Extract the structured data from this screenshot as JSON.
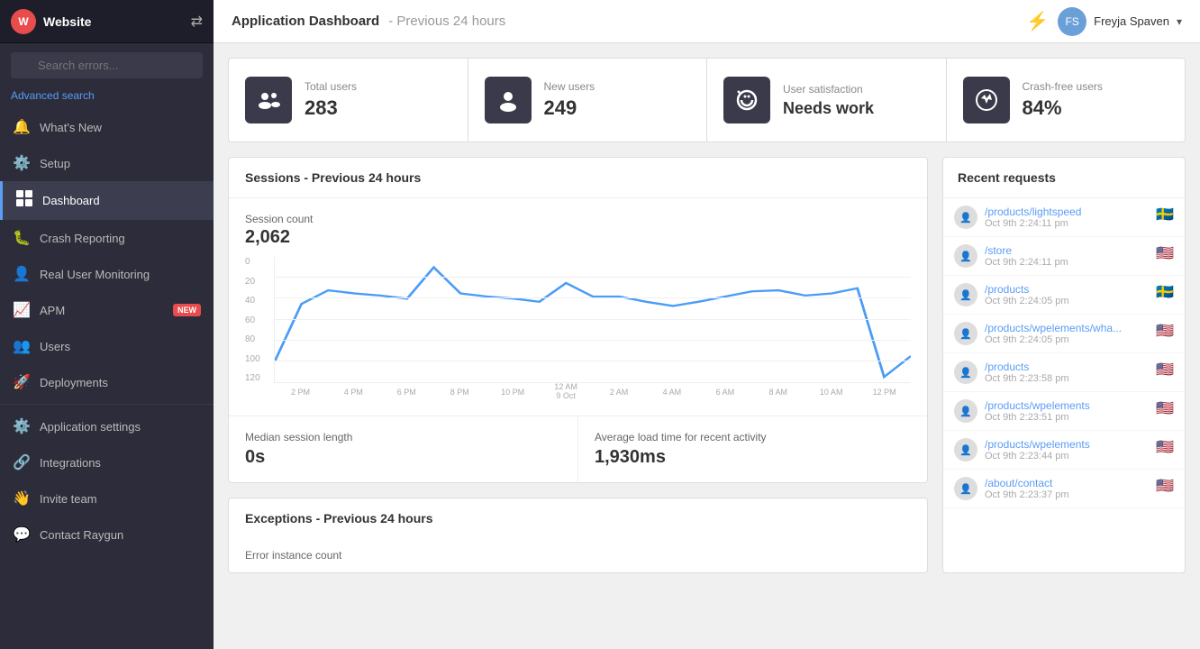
{
  "app": {
    "name": "Website",
    "icon_letter": "W"
  },
  "topbar": {
    "lightning_icon": "⚡",
    "page_title": "Application Dashboard",
    "page_subtitle": "- Previous 24 hours",
    "user_name": "Freyja Spaven",
    "user_initials": "FS"
  },
  "search": {
    "placeholder": "Search errors...",
    "advanced_link": "Advanced search"
  },
  "nav": {
    "items": [
      {
        "id": "whats-new",
        "label": "What's New",
        "icon": "🔔",
        "active": false
      },
      {
        "id": "setup",
        "label": "Setup",
        "icon": "⚙️",
        "active": false
      },
      {
        "id": "dashboard",
        "label": "Dashboard",
        "icon": "📊",
        "active": true
      },
      {
        "id": "crash-reporting",
        "label": "Crash Reporting",
        "icon": "🐛",
        "active": false
      },
      {
        "id": "real-user-monitoring",
        "label": "Real User Monitoring",
        "icon": "👤",
        "active": false
      },
      {
        "id": "apm",
        "label": "APM",
        "icon": "📈",
        "active": false,
        "badge": "NEW"
      },
      {
        "id": "users",
        "label": "Users",
        "icon": "👥",
        "active": false
      },
      {
        "id": "deployments",
        "label": "Deployments",
        "icon": "🚀",
        "active": false
      },
      {
        "id": "application-settings",
        "label": "Application settings",
        "icon": "⚙️",
        "active": false
      },
      {
        "id": "integrations",
        "label": "Integrations",
        "icon": "🔗",
        "active": false
      },
      {
        "id": "invite-team",
        "label": "Invite team",
        "icon": "👋",
        "active": false
      },
      {
        "id": "contact-raygun",
        "label": "Contact Raygun",
        "icon": "💬",
        "active": false
      }
    ]
  },
  "stats": [
    {
      "id": "total-users",
      "label": "Total users",
      "value": "283",
      "icon": "👥"
    },
    {
      "id": "new-users",
      "label": "New users",
      "value": "249",
      "icon": "👤"
    },
    {
      "id": "user-satisfaction",
      "label": "User satisfaction",
      "value": "Needs work",
      "icon": "⏱"
    },
    {
      "id": "crash-free-users",
      "label": "Crash-free users",
      "value": "84%",
      "icon": "⚙"
    }
  ],
  "sessions": {
    "panel_title": "Sessions - Previous 24 hours",
    "session_count_label": "Session count",
    "session_count_value": "2,062",
    "median_label": "Median session length",
    "median_value": "0s",
    "avg_load_label": "Average load time for recent activity",
    "avg_load_value": "1,930ms"
  },
  "chart": {
    "x_labels": [
      "2 PM",
      "4 PM",
      "6 PM",
      "8 PM",
      "10 PM",
      "12 AM\n9 Oct",
      "2 AM",
      "4 AM",
      "6 AM",
      "8 AM",
      "10 AM",
      "12 PM"
    ],
    "y_labels": [
      "120",
      "100",
      "80",
      "60",
      "40",
      "20",
      "0"
    ],
    "points": [
      40,
      85,
      92,
      90,
      88,
      86,
      120,
      90,
      88,
      86,
      84,
      96,
      86,
      86,
      84,
      80,
      84,
      86,
      90,
      92,
      88,
      90,
      96,
      30
    ]
  },
  "recent_requests": {
    "title": "Recent requests",
    "items": [
      {
        "path": "/products/lightspeed",
        "time": "Oct 9th 2:24:11 pm",
        "flag": "🇸🇪"
      },
      {
        "path": "/store",
        "time": "Oct 9th 2:24:11 pm",
        "flag": "🇺🇸"
      },
      {
        "path": "/products",
        "time": "Oct 9th 2:24:05 pm",
        "flag": "🇸🇪"
      },
      {
        "path": "/products/wpelements/wha...",
        "time": "Oct 9th 2:24:05 pm",
        "flag": "🇺🇸"
      },
      {
        "path": "/products",
        "time": "Oct 9th 2:23:58 pm",
        "flag": "🇺🇸"
      },
      {
        "path": "/products/wpelements",
        "time": "Oct 9th 2:23:51 pm",
        "flag": "🇺🇸"
      },
      {
        "path": "/products/wpelements",
        "time": "Oct 9th 2:23:44 pm",
        "flag": "🇺🇸"
      },
      {
        "path": "/about/contact",
        "time": "Oct 9th 2:23:37 pm",
        "flag": "🇺🇸"
      }
    ]
  },
  "exceptions": {
    "title": "Exceptions - Previous 24 hours",
    "count_label": "Error instance count"
  }
}
